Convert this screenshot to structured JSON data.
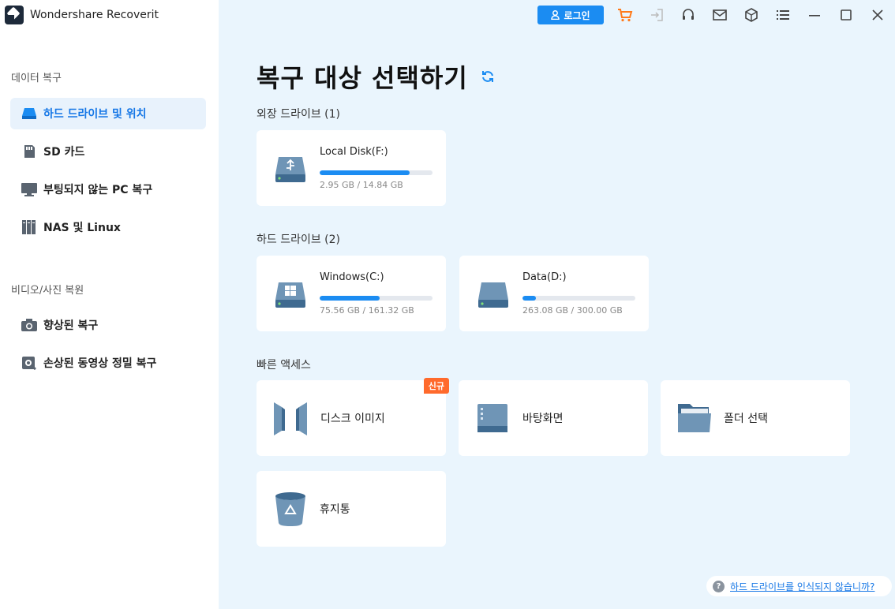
{
  "app": {
    "title": "Wondershare Recoverit"
  },
  "sidebar": {
    "data_recovery_label": "데이터 복구",
    "data_items": [
      {
        "label": "하드 드라이브 및 위치",
        "icon": "hard-drive-icon",
        "active": true
      },
      {
        "label": "SD 카드",
        "icon": "sd-card-icon"
      },
      {
        "label": "부팅되지 않는 PC 복구",
        "icon": "monitor-icon"
      },
      {
        "label": "NAS 및 Linux",
        "icon": "nas-icon"
      }
    ],
    "media_label": "비디오/사진 복원",
    "media_items": [
      {
        "label": "향상된 복구",
        "icon": "camera-icon"
      },
      {
        "label": "손상된 동영상 정밀 복구",
        "icon": "video-repair-icon"
      }
    ]
  },
  "topbar": {
    "login_label": "로그인",
    "icons": [
      "user-icon",
      "cart-icon",
      "sign-in-icon",
      "headset-icon",
      "mail-icon",
      "cube-icon",
      "menu-icon",
      "minimize-icon",
      "maximize-icon",
      "close-icon"
    ]
  },
  "main": {
    "title": "복구 대상 선택하기",
    "external_label": "외장 드라이브 (1)",
    "external_drives": [
      {
        "name": "Local Disk(F:)",
        "size": "2.95 GB / 14.84 GB",
        "used_fraction": 0.8
      }
    ],
    "hard_label": "하드 드라이브 (2)",
    "hard_drives": [
      {
        "name": "Windows(C:)",
        "size": "75.56 GB / 161.32 GB",
        "used_fraction": 0.53
      },
      {
        "name": "Data(D:)",
        "size": "263.08 GB / 300.00 GB",
        "used_fraction": 0.12
      }
    ],
    "quick_label": "빠른 액세스",
    "quick_items": [
      {
        "label": "디스크 이미지",
        "badge": "신규"
      },
      {
        "label": "바탕화면"
      },
      {
        "label": "폴더 선택"
      },
      {
        "label": "휴지통"
      }
    ]
  },
  "help": {
    "text": "하드 드라이브를 인식되지 않습니까?",
    "q": "?"
  },
  "colors": {
    "accent": "#1b8cf2",
    "badge": "#ff6a2c",
    "main_bg": "#eaf5fd"
  }
}
